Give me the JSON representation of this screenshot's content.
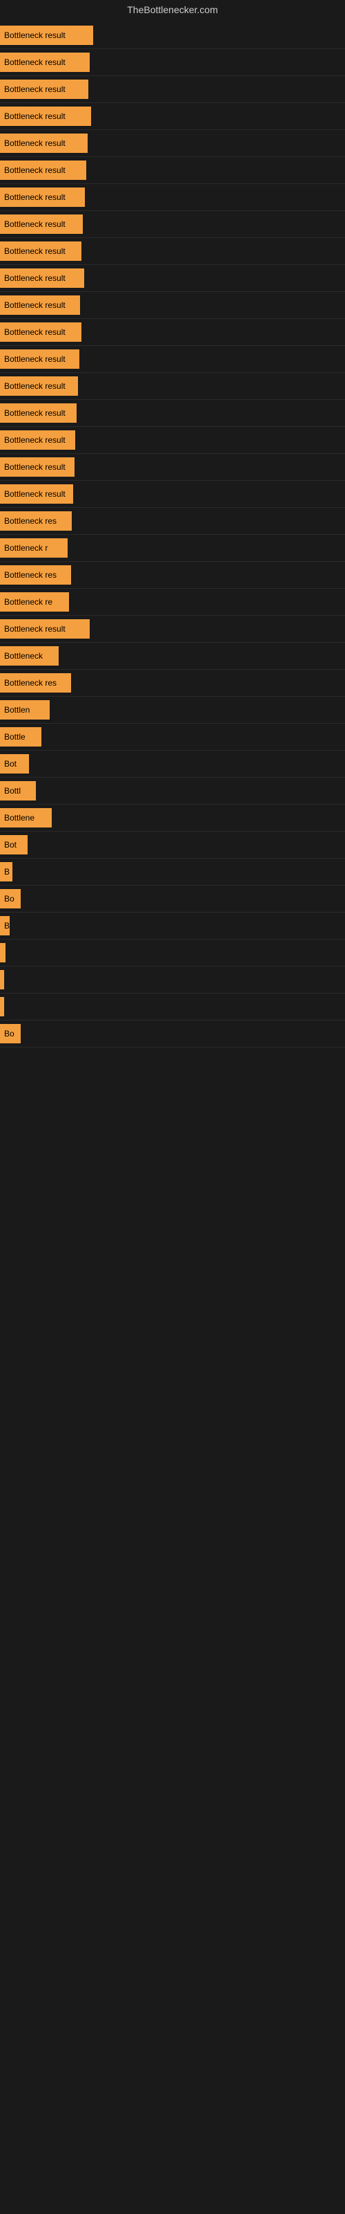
{
  "site": {
    "title": "TheBottlenecker.com"
  },
  "bars": [
    {
      "label": "Bottleneck result",
      "width": 135,
      "height": 28
    },
    {
      "label": "Bottleneck result",
      "width": 130,
      "height": 28
    },
    {
      "label": "Bottleneck result",
      "width": 128,
      "height": 28
    },
    {
      "label": "Bottleneck result",
      "width": 132,
      "height": 28
    },
    {
      "label": "Bottleneck result",
      "width": 127,
      "height": 28
    },
    {
      "label": "Bottleneck result",
      "width": 125,
      "height": 28
    },
    {
      "label": "Bottleneck result",
      "width": 123,
      "height": 28
    },
    {
      "label": "Bottleneck result",
      "width": 120,
      "height": 28
    },
    {
      "label": "Bottleneck result",
      "width": 118,
      "height": 28
    },
    {
      "label": "Bottleneck result",
      "width": 122,
      "height": 28
    },
    {
      "label": "Bottleneck result",
      "width": 116,
      "height": 28
    },
    {
      "label": "Bottleneck result",
      "width": 118,
      "height": 28
    },
    {
      "label": "Bottleneck result",
      "width": 115,
      "height": 28
    },
    {
      "label": "Bottleneck result",
      "width": 113,
      "height": 28
    },
    {
      "label": "Bottleneck result",
      "width": 111,
      "height": 28
    },
    {
      "label": "Bottleneck result",
      "width": 109,
      "height": 28
    },
    {
      "label": "Bottleneck result",
      "width": 108,
      "height": 28
    },
    {
      "label": "Bottleneck result",
      "width": 106,
      "height": 28
    },
    {
      "label": "Bottleneck res",
      "width": 104,
      "height": 28
    },
    {
      "label": "Bottleneck r",
      "width": 98,
      "height": 28
    },
    {
      "label": "Bottleneck res",
      "width": 103,
      "height": 28
    },
    {
      "label": "Bottleneck re",
      "width": 100,
      "height": 28
    },
    {
      "label": "Bottleneck result",
      "width": 130,
      "height": 28
    },
    {
      "label": "Bottleneck",
      "width": 85,
      "height": 28
    },
    {
      "label": "Bottleneck res",
      "width": 103,
      "height": 28
    },
    {
      "label": "Bottlen",
      "width": 72,
      "height": 28
    },
    {
      "label": "Bottle",
      "width": 60,
      "height": 28
    },
    {
      "label": "Bot",
      "width": 42,
      "height": 28
    },
    {
      "label": "Bottl",
      "width": 52,
      "height": 28
    },
    {
      "label": "Bottlene",
      "width": 75,
      "height": 28
    },
    {
      "label": "Bot",
      "width": 40,
      "height": 28
    },
    {
      "label": "B",
      "width": 18,
      "height": 28
    },
    {
      "label": "Bo",
      "width": 30,
      "height": 28
    },
    {
      "label": "B",
      "width": 14,
      "height": 28
    },
    {
      "label": "",
      "width": 8,
      "height": 28
    },
    {
      "label": "",
      "width": 6,
      "height": 28
    },
    {
      "label": "",
      "width": 4,
      "height": 28
    },
    {
      "label": "Bo",
      "width": 30,
      "height": 28
    }
  ]
}
